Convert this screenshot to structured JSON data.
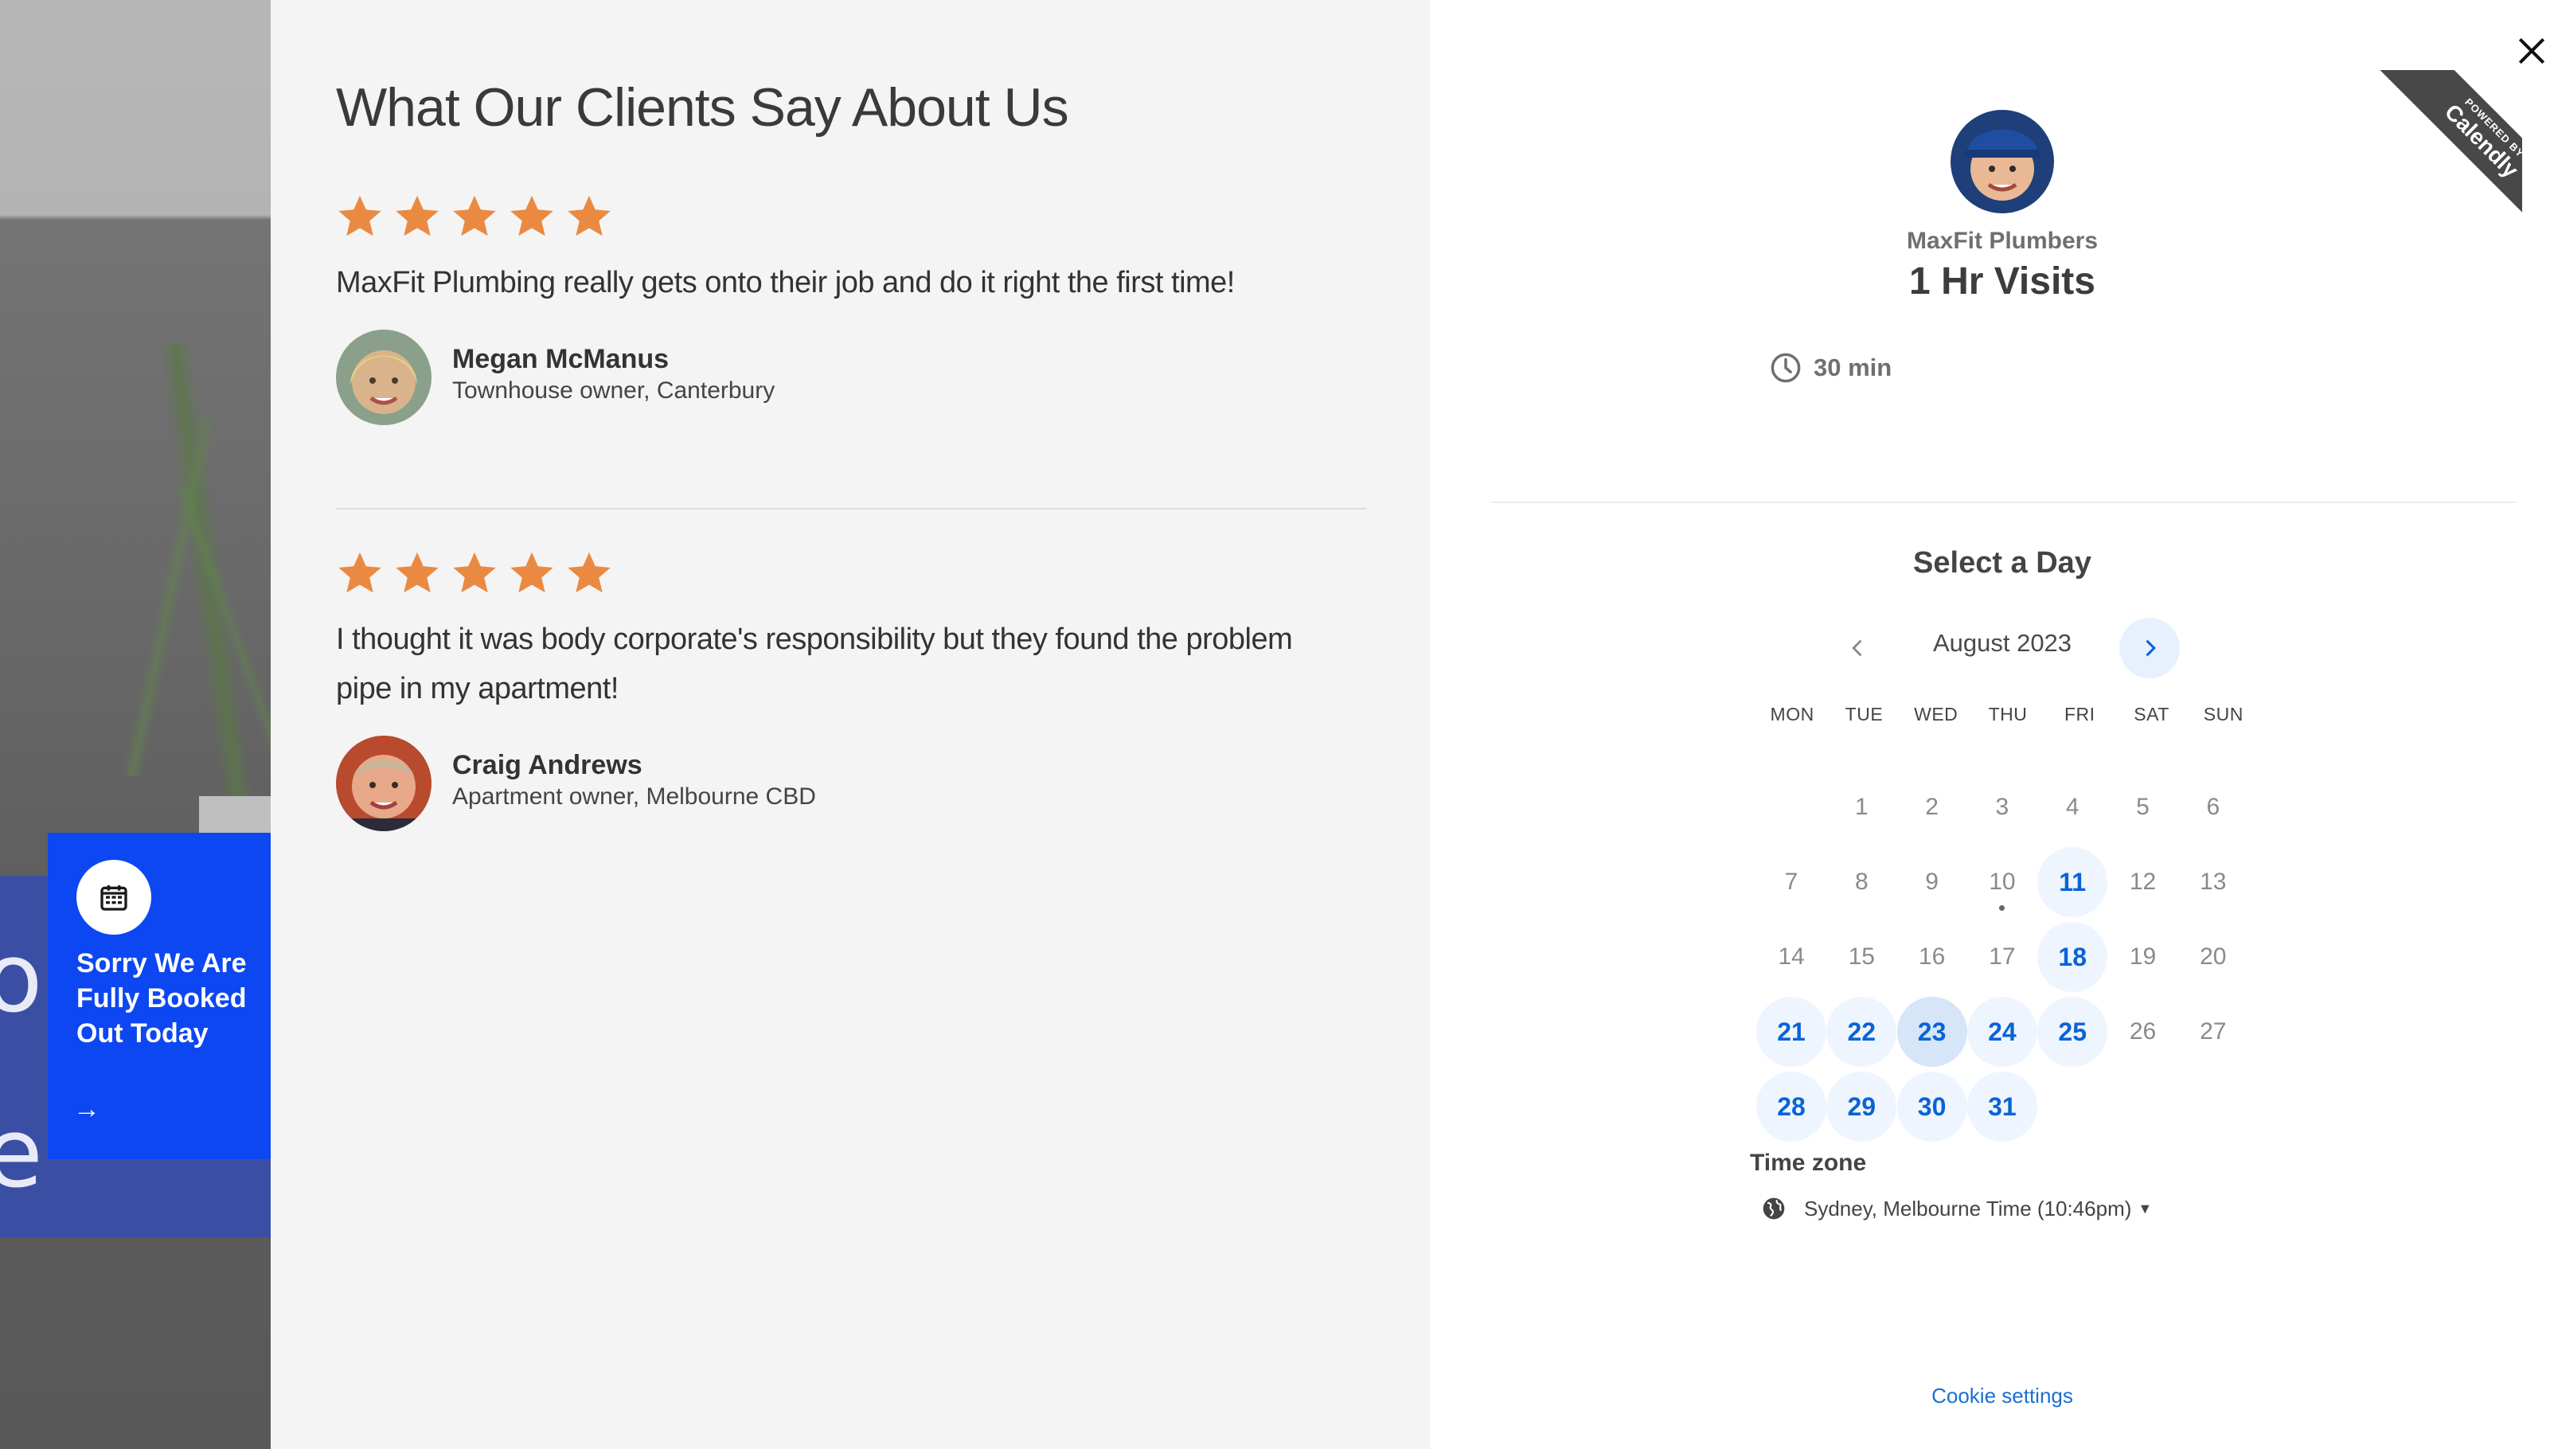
{
  "theme": {
    "accent": "#0a63d6",
    "star": "#ea8a42",
    "promo_blue": "#0d47f2"
  },
  "background": {
    "letters": "ol\ne"
  },
  "promo": {
    "title": "Sorry We Are Fully Booked Out Today",
    "icon": "calendar-icon",
    "arrow": "→"
  },
  "testimonials": {
    "heading": "What Our Clients Say About Us",
    "reviews": [
      {
        "rating": 5,
        "quote": "MaxFit Plumbing really gets onto their job and do it right the first time!",
        "name": "Megan McManus",
        "role": "Townhouse owner, Canterbury"
      },
      {
        "rating": 5,
        "quote": "I thought it was body corporate's responsibility but they found the problem pipe in my apartment!",
        "name": "Craig Andrews",
        "role": "Apartment owner, Melbourne CBD"
      }
    ]
  },
  "calendly": {
    "ribbon_top": "POWERED BY",
    "ribbon_brand": "Calendly",
    "host": "MaxFit Plumbers",
    "event": "1 Hr Visits",
    "duration": "30 min",
    "select_day": "Select a Day",
    "month": "August 2023",
    "weekdays": [
      "MON",
      "TUE",
      "WED",
      "THU",
      "FRI",
      "SAT",
      "SUN"
    ],
    "days": [
      "1",
      "2",
      "3",
      "4",
      "5",
      "6",
      "7",
      "8",
      "9",
      "10",
      "11",
      "12",
      "13",
      "14",
      "15",
      "16",
      "17",
      "18",
      "19",
      "20",
      "21",
      "22",
      "23",
      "24",
      "25",
      "26",
      "27",
      "28",
      "29",
      "30",
      "31"
    ],
    "available_days": [
      11,
      18,
      21,
      22,
      23,
      24,
      25,
      28,
      29,
      30,
      31
    ],
    "selected_day": 23,
    "today": 10,
    "timezone_label": "Time zone",
    "timezone_value": "Sydney, Melbourne Time (10:46pm)",
    "cookie": "Cookie settings"
  }
}
